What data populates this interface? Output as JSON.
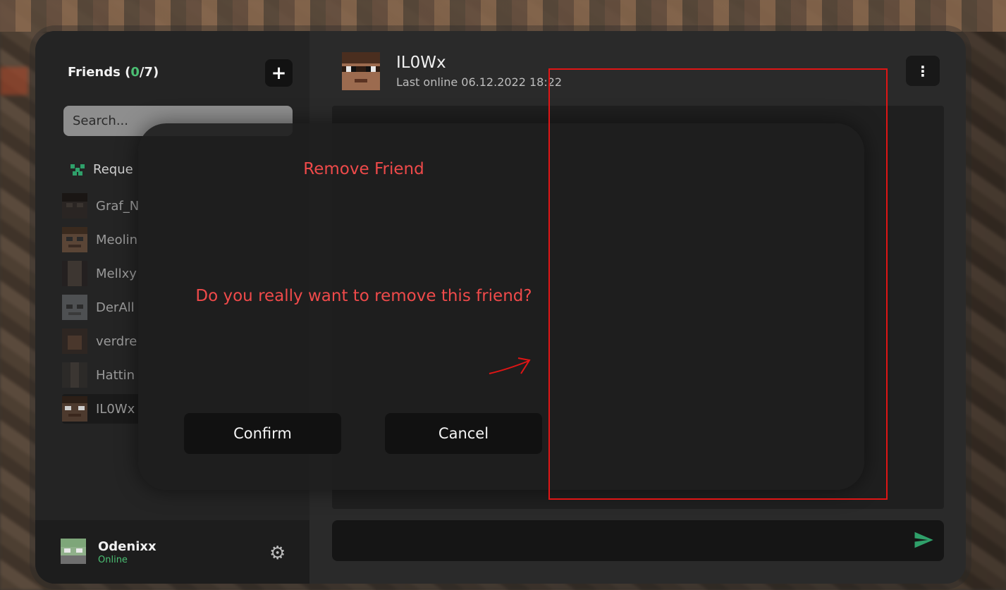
{
  "sidebar": {
    "title_prefix": "Friends (",
    "online_count": "0",
    "separator": "/",
    "total_count": "7",
    "title_suffix": ")",
    "add_button": "+",
    "search_placeholder": "Search...",
    "requests_label": "Reque",
    "friends": [
      {
        "name": "Graf_N",
        "active": false
      },
      {
        "name": "Meolin",
        "active": false
      },
      {
        "name": "Mellxy",
        "active": false
      },
      {
        "name": "DerAll",
        "active": false
      },
      {
        "name": "verdre",
        "active": false
      },
      {
        "name": "Hattin",
        "active": false
      },
      {
        "name": "IL0Wx",
        "active": true
      }
    ]
  },
  "current_user": {
    "name": "Odenixx",
    "status": "Online",
    "settings_icon": "gear-icon"
  },
  "chat": {
    "name": "IL0Wx",
    "last_online": "Last online 06.12.2022 18:22",
    "menu_icon": "vertical-dots-icon",
    "send_icon": "send-icon"
  },
  "modal": {
    "title": "Remove Friend",
    "message": "Do you really want to remove this friend?",
    "confirm_label": "Confirm",
    "cancel_label": "Cancel"
  },
  "colors": {
    "accent_green": "#4bbf73",
    "danger_red": "#ef4a4a",
    "annotation_red": "#e01515"
  }
}
